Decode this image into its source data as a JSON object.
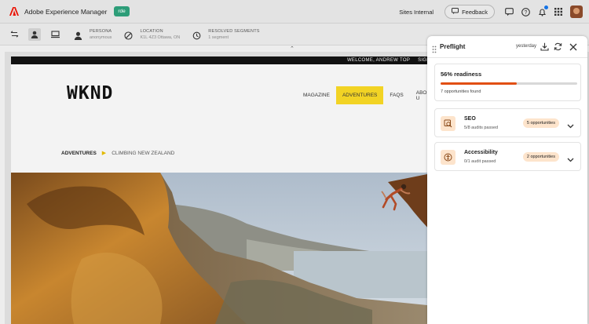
{
  "app": {
    "name": "Adobe Experience Manager",
    "env_badge": "rde",
    "sites_link": "Sites Internal",
    "feedback_label": "Feedback"
  },
  "subbar": {
    "persona_label": "PERSONA",
    "persona_value": "anonymous",
    "location_label": "LOCATION",
    "location_value": "K1L 4Z3 Ottawa, ON",
    "segments_label": "RESOLVED SEGMENTS",
    "segments_value": "1 segment"
  },
  "site": {
    "welcome": "WELCOME, ANDREW TOP",
    "sign": "SIGN",
    "logo": "WKND",
    "nav": [
      "MAGAZINE",
      "ADVENTURES",
      "FAQS",
      "ABOUT U"
    ],
    "breadcrumb": [
      "ADVENTURES",
      "CLIMBING NEW ZEALAND"
    ]
  },
  "preflight": {
    "title": "Preflight",
    "date": "yesterday",
    "readiness_title": "56% readiness",
    "readiness_value": 56,
    "opportunities_found": "7 opportunities found",
    "categories": [
      {
        "title": "SEO",
        "audits": "5/8 audits passed",
        "badge": "5 opportunities"
      },
      {
        "title": "Accessibility",
        "audits": "0/1 audit passed",
        "badge": "2 opportunities"
      }
    ]
  },
  "colors": {
    "accent_orange": "#e14f13",
    "badge_bg": "#fde4cc",
    "env_green": "#2d9d78",
    "adventures_yellow": "#f2d324"
  }
}
